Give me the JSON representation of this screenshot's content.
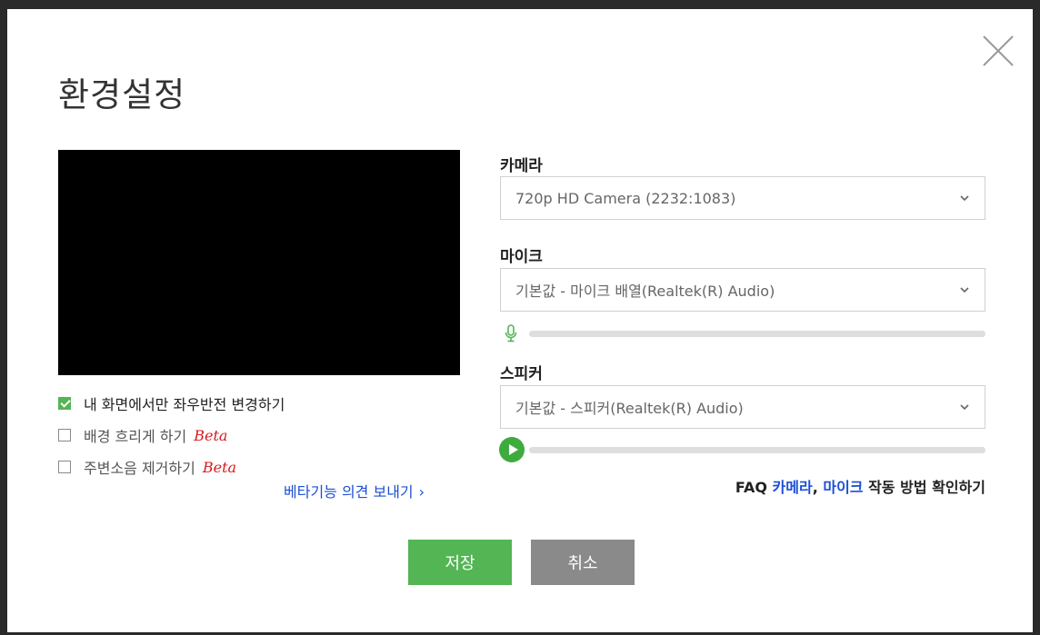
{
  "dialog": {
    "title": "환경설정",
    "close_icon": "close-icon"
  },
  "options": [
    {
      "label": "내 화면에서만 좌우반전 변경하기",
      "checked": true,
      "beta": ""
    },
    {
      "label": "배경 흐리게 하기",
      "checked": false,
      "beta": "Beta"
    },
    {
      "label": "주변소음 제거하기",
      "checked": false,
      "beta": "Beta"
    }
  ],
  "beta_feedback": {
    "label": "베타기능 의견 보내기",
    "chevron": "›"
  },
  "camera": {
    "label": "카메라",
    "value": "720p HD Camera (2232:1083)"
  },
  "mic": {
    "label": "마이크",
    "value": "기본값 - 마이크 배열(Realtek(R) Audio)",
    "level": 0
  },
  "speaker": {
    "label": "스피커",
    "value": "기본값 - 스피커(Realtek(R) Audio)",
    "level": 0
  },
  "faq": {
    "prefix": "FAQ ",
    "link_camera": "카메라",
    "comma": ", ",
    "link_mic": "마이크",
    "suffix": " 작동 방법 확인하기"
  },
  "buttons": {
    "save": "저장",
    "cancel": "취소"
  },
  "colors": {
    "accent": "#53b554",
    "link": "#1a4fd6",
    "beta": "#d7191e",
    "cancel": "#8a8a8a"
  }
}
